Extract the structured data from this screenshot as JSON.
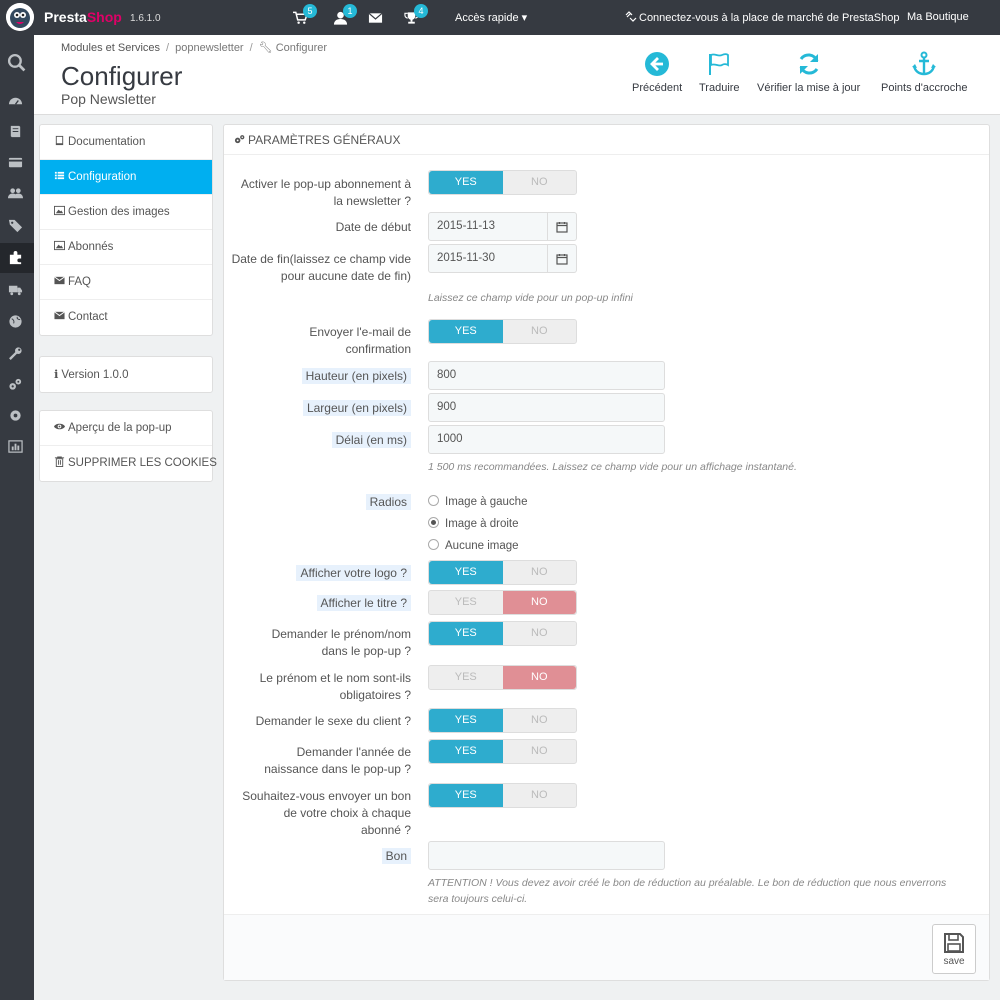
{
  "topbar": {
    "brand_a": "Presta",
    "brand_b": "Shop",
    "version": "1.6.1.0",
    "badges": {
      "orders": "5",
      "customers": "1",
      "messages": "",
      "trophies": "4"
    },
    "quick_access": "Accès rapide",
    "marketplace": "Connectez-vous à la place de marché de PrestaShop",
    "shop_name": "Ma Boutique"
  },
  "header": {
    "breadcrumb": [
      "Modules et Services",
      "popnewsletter",
      "Configurer"
    ],
    "title": "Configurer",
    "subtitle": "Pop Newsletter",
    "toolbar": [
      {
        "label": "Précédent",
        "icon": "back-arrow-icon"
      },
      {
        "label": "Traduire",
        "icon": "flag-icon"
      },
      {
        "label": "Vérifier la mise à jour",
        "icon": "refresh-icon"
      },
      {
        "label": "Points d'accroche",
        "icon": "anchor-icon"
      }
    ]
  },
  "sidebar": {
    "menu": [
      {
        "label": "Documentation",
        "icon": "book-icon"
      },
      {
        "label": "Configuration",
        "icon": "list-icon",
        "active": true
      },
      {
        "label": "Gestion des images",
        "icon": "image-icon"
      },
      {
        "label": "Abonnés",
        "icon": "image-icon"
      },
      {
        "label": "FAQ",
        "icon": "envelope-icon"
      },
      {
        "label": "Contact",
        "icon": "envelope-icon"
      }
    ],
    "version": "Version 1.0.0",
    "actions": [
      {
        "label": "Aperçu de la pop-up",
        "icon": "eye-icon"
      },
      {
        "label": "SUPPRIMER LES COOKIES",
        "icon": "trash-icon"
      }
    ]
  },
  "panel": {
    "heading": "Paramètres généraux",
    "yes": "YES",
    "no": "NO",
    "fields": {
      "activate": {
        "label": "Activer le pop-up abonnement à la newsletter ?",
        "value": "yes"
      },
      "start_date": {
        "label": "Date de début",
        "value": "2015-11-13"
      },
      "end_date": {
        "label": "Date de fin(laissez ce champ vide pour aucune date de fin)",
        "value": "2015-11-30",
        "help": "Laissez ce champ vide pour un pop-up infini"
      },
      "confirm_email": {
        "label": "Envoyer l'e-mail de confirmation",
        "value": "yes"
      },
      "height": {
        "label": "Hauteur (en pixels)",
        "value": "800"
      },
      "width": {
        "label": "Largeur (en pixels)",
        "value": "900"
      },
      "delay": {
        "label": "Délai (en ms)",
        "value": "1000",
        "help": "1 500 ms recommandées. Laissez ce champ vide pour un affichage instantané."
      },
      "radios": {
        "label": "Radios",
        "options": [
          "Image à gauche",
          "Image à droite",
          "Aucune image"
        ],
        "selected": "Image à droite"
      },
      "show_logo": {
        "label": "Afficher votre logo ?",
        "value": "yes"
      },
      "show_title": {
        "label": "Afficher le titre ?",
        "value": "no"
      },
      "ask_name": {
        "label": "Demander le prénom/nom dans le pop-up ?",
        "value": "yes"
      },
      "name_required": {
        "label": "Le prénom et le nom sont-ils obligatoires ?",
        "value": "no"
      },
      "ask_gender": {
        "label": "Demander le sexe du client ?",
        "value": "yes"
      },
      "ask_birth": {
        "label": "Demander l'année de naissance dans le pop-up ?",
        "value": "yes"
      },
      "send_voucher": {
        "label": "Souhaitez-vous envoyer un bon de votre choix à chaque abonné ?",
        "value": "yes"
      },
      "voucher": {
        "label": "Bon",
        "value": "",
        "help": "ATTENTION ! Vous devez avoir créé le bon de réduction au préalable. Le bon de réduction que nous enverrons sera toujours celui-ci."
      }
    },
    "save": "save"
  },
  "colors": {
    "accent": "#00aff0",
    "yes": "#2eacce",
    "no": "#e08f95",
    "nav": "#363a41"
  }
}
